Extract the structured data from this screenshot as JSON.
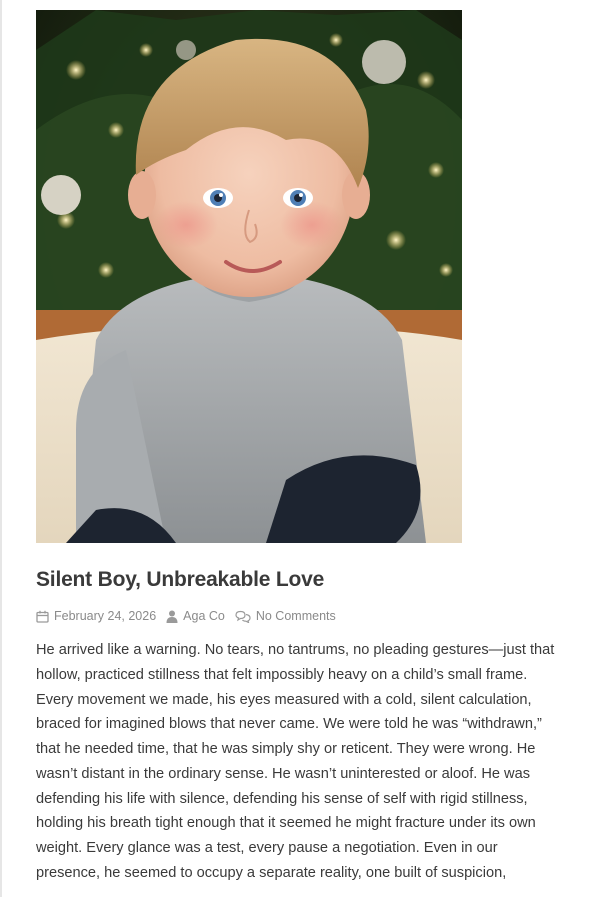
{
  "post": {
    "title": "Silent Boy, Unbreakable Love",
    "meta": {
      "date": "February 24, 2026",
      "author": "Aga Co",
      "comments": "No Comments"
    },
    "content_lines": [
      "He arrived like a warning. No tears, no tantrums, no pleading gestures—just that",
      "hollow, practiced stillness that felt impossibly heavy on a child’s small frame.",
      "Every movement we made, his eyes measured with a cold, silent calculation,",
      "braced for imagined blows that never came. We were told he was “withdrawn,”",
      "that he needed time, that he was simply shy or reticent. They were wrong. He",
      "wasn’t distant in the ordinary sense. He wasn’t uninterested or aloof. He was",
      "defending his life with silence, defending his sense of self with rigid stillness,",
      "holding his breath tight enough that it seemed he might fracture under its own",
      "weight. Every glance was a test, every pause a negotiation. Even in our",
      "presence, he seemed to occupy a separate reality, one built of suspicion,"
    ]
  },
  "icons": {
    "date": "calendar-icon",
    "author": "user-icon",
    "comments": "comments-icon"
  },
  "colors": {
    "title": "#3a3a3a",
    "meta": "#8a8a8a",
    "body_text": "#3a3a3a"
  }
}
